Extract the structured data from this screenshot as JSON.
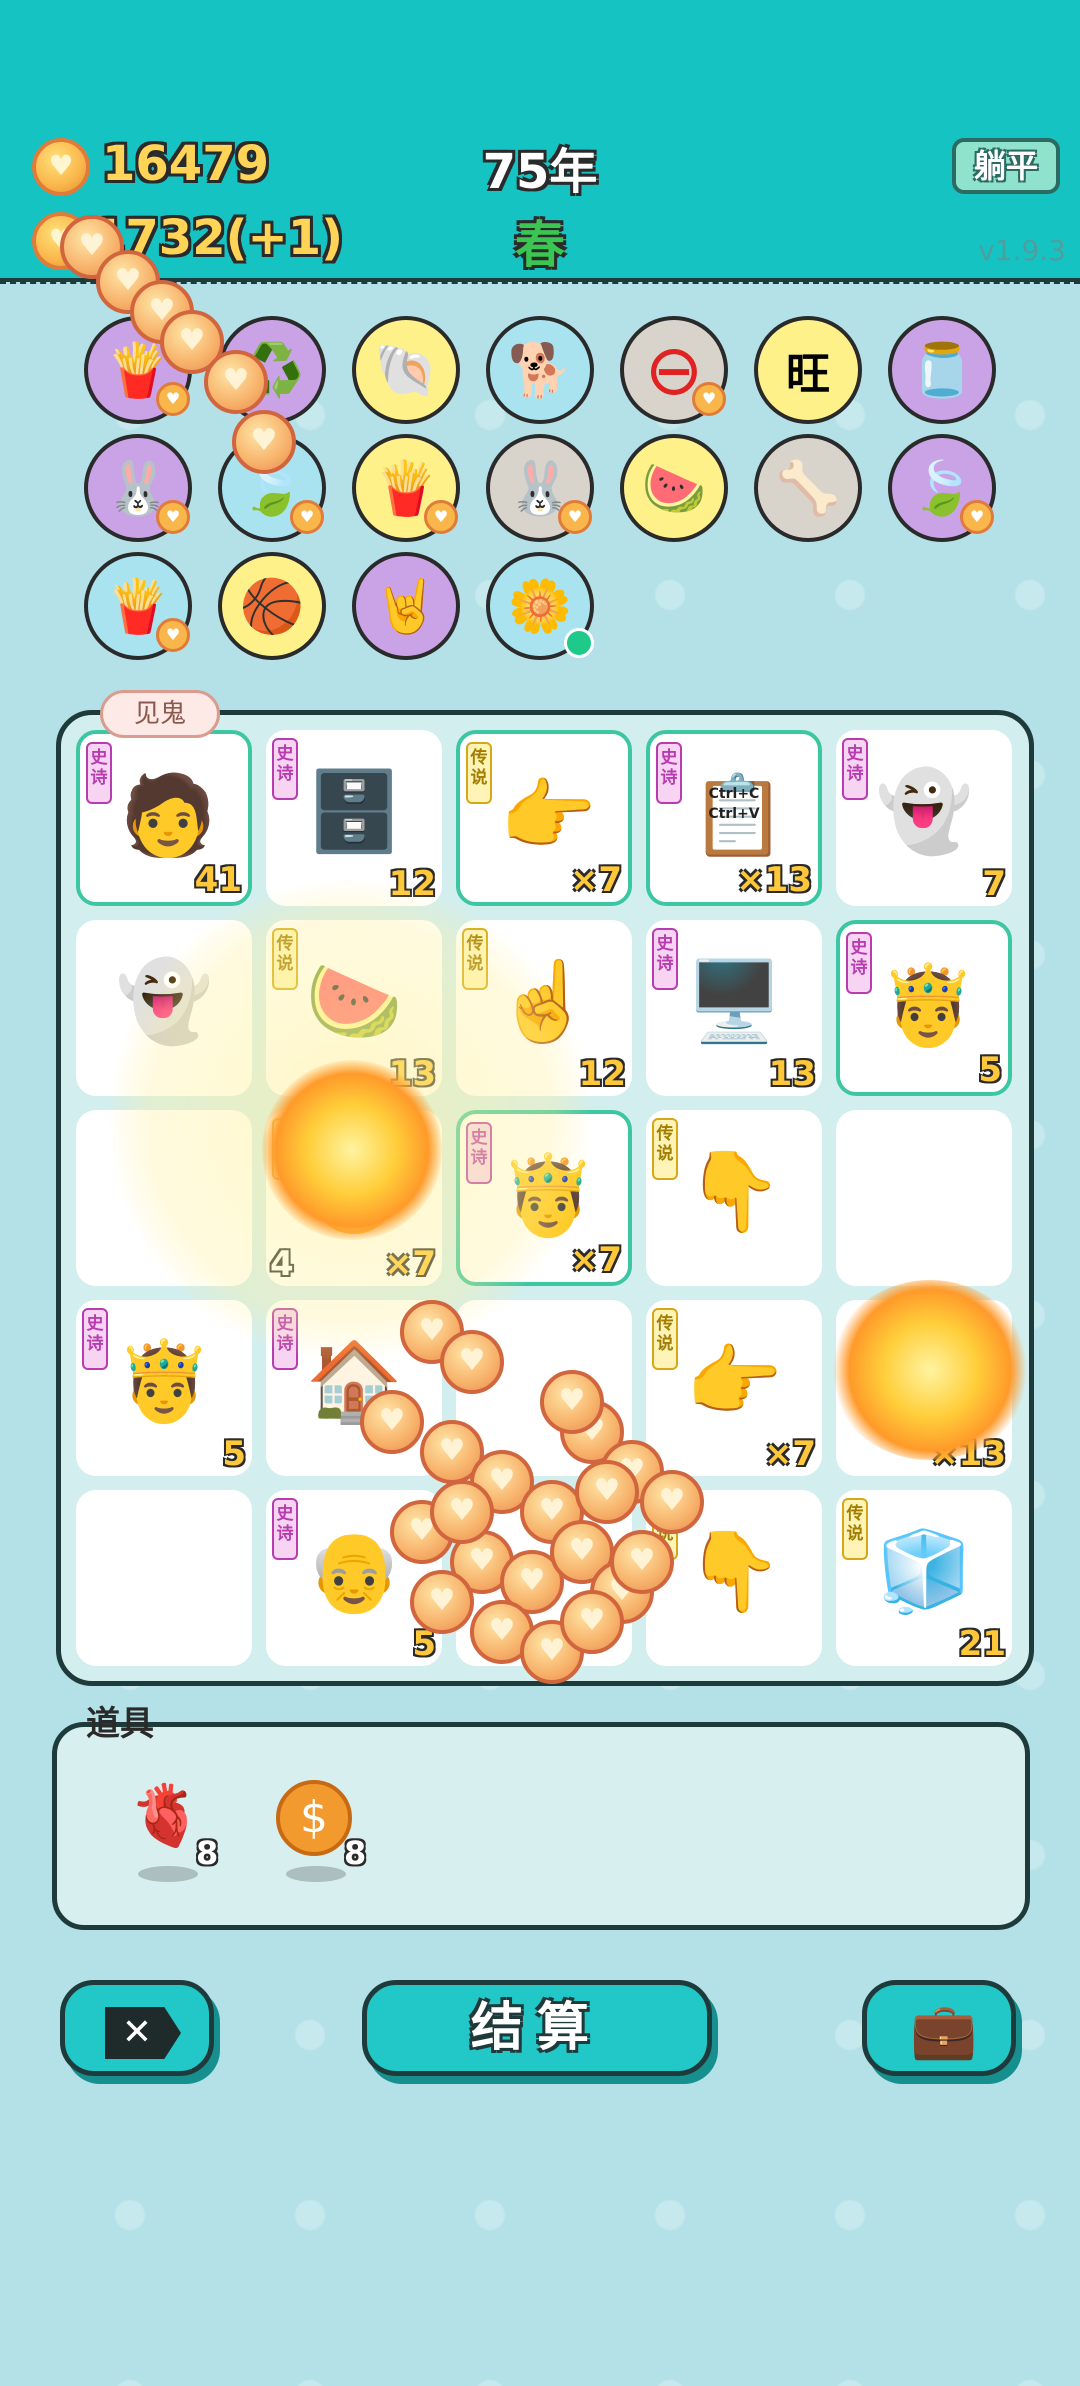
{
  "header": {
    "coins": "16479",
    "income": "1732(+1)",
    "year": "75年",
    "season": "春",
    "tangping_label": "躺平",
    "version": "v1.9.3"
  },
  "collection": [
    {
      "name": "fries",
      "glyph": "🍟",
      "color": "purple"
    },
    {
      "name": "recycle",
      "glyph": "♻️",
      "color": "purple"
    },
    {
      "name": "shell",
      "glyph": "🐚",
      "color": "yellow"
    },
    {
      "name": "dog",
      "glyph": "🐕",
      "color": "blue"
    },
    {
      "name": "ban",
      "glyph": "⊖",
      "color": "gray"
    },
    {
      "name": "wang",
      "glyph": "旺",
      "color": "yellow"
    },
    {
      "name": "jar",
      "glyph": "🫙",
      "color": "purple"
    },
    {
      "name": "rabbit",
      "glyph": "🐰",
      "color": "purple"
    },
    {
      "name": "leaf",
      "glyph": "🍃",
      "color": "blue"
    },
    {
      "name": "fries2",
      "glyph": "🍟",
      "color": "yellow"
    },
    {
      "name": "rabbit2",
      "glyph": "🐰",
      "color": "gray"
    },
    {
      "name": "fruit-basket",
      "glyph": "🍉",
      "color": "yellow"
    },
    {
      "name": "dog-bowl",
      "glyph": "🦴",
      "color": "gray"
    },
    {
      "name": "leaf2",
      "glyph": "🍃",
      "color": "purple"
    },
    {
      "name": "fries3",
      "glyph": "🍟",
      "color": "blue"
    },
    {
      "name": "basketballs",
      "glyph": "🏀",
      "color": "yellow"
    },
    {
      "name": "rock-hand",
      "glyph": "🤘",
      "color": "purple"
    },
    {
      "name": "flower-pot",
      "glyph": "🌼",
      "color": "blue"
    }
  ],
  "bubble": "见鬼",
  "board": [
    {
      "glyph": "🧑",
      "rarity": "史诗",
      "value": "41",
      "framed": true
    },
    {
      "glyph": "🗄️",
      "rarity": "史诗",
      "value": "12",
      "framed": false
    },
    {
      "glyph": "👉",
      "rarity": "传说",
      "value": "×7",
      "framed": true
    },
    {
      "glyph": "📋",
      "rarity": "史诗",
      "value": "×13",
      "framed": true,
      "caption": "Ctrl+C Ctrl+V"
    },
    {
      "glyph": "👻",
      "rarity": "史诗",
      "value": "7",
      "framed": false
    },
    {
      "glyph": "👻",
      "rarity": "",
      "value": "",
      "framed": false
    },
    {
      "glyph": "🍉",
      "rarity": "传说",
      "value": "13",
      "framed": false
    },
    {
      "glyph": "☝️",
      "rarity": "传说",
      "value": "12",
      "framed": false
    },
    {
      "glyph": "🖥️",
      "rarity": "史诗",
      "value": "13",
      "framed": false
    },
    {
      "glyph": "🤴",
      "rarity": "史诗",
      "value": "5",
      "framed": true
    },
    {
      "glyph": "",
      "rarity": "",
      "value": "",
      "framed": false
    },
    {
      "glyph": "🟡",
      "rarity": "传说",
      "value": "×7",
      "framed": false,
      "left_value": "4"
    },
    {
      "glyph": "🤴",
      "rarity": "史诗",
      "value": "×7",
      "framed": true
    },
    {
      "glyph": "👇",
      "rarity": "传说",
      "value": "",
      "framed": false
    },
    {
      "glyph": "",
      "rarity": "",
      "value": "",
      "framed": false
    },
    {
      "glyph": "🤴",
      "rarity": "史诗",
      "value": "5",
      "framed": false
    },
    {
      "glyph": "🏠",
      "rarity": "史诗",
      "value": "",
      "framed": false
    },
    {
      "glyph": "",
      "rarity": "",
      "value": "",
      "framed": false
    },
    {
      "glyph": "👉",
      "rarity": "传说",
      "value": "×7",
      "framed": false
    },
    {
      "glyph": "🍲",
      "rarity": "",
      "value": "×13",
      "framed": false
    },
    {
      "glyph": "",
      "rarity": "",
      "value": "",
      "framed": false
    },
    {
      "glyph": "👴",
      "rarity": "史诗",
      "value": "5",
      "framed": false
    },
    {
      "glyph": "",
      "rarity": "",
      "value": "",
      "framed": false
    },
    {
      "glyph": "👇",
      "rarity": "传说",
      "value": "",
      "framed": false
    },
    {
      "glyph": "🧊",
      "rarity": "传说",
      "value": "21",
      "framed": false
    }
  ],
  "props": {
    "label": "道具",
    "items": [
      {
        "name": "liver",
        "glyph": "🫀",
        "count": "8"
      },
      {
        "name": "dollar-coin",
        "glyph": "💲",
        "count": "8"
      }
    ]
  },
  "buttons": {
    "settle": "结算"
  },
  "colors": {
    "header_bg": "#16c3c3",
    "page_bg": "#b3e1e7",
    "button_bg": "#22c7c7",
    "number_gold": "#ffc83a",
    "season_green": "#3bc552"
  }
}
